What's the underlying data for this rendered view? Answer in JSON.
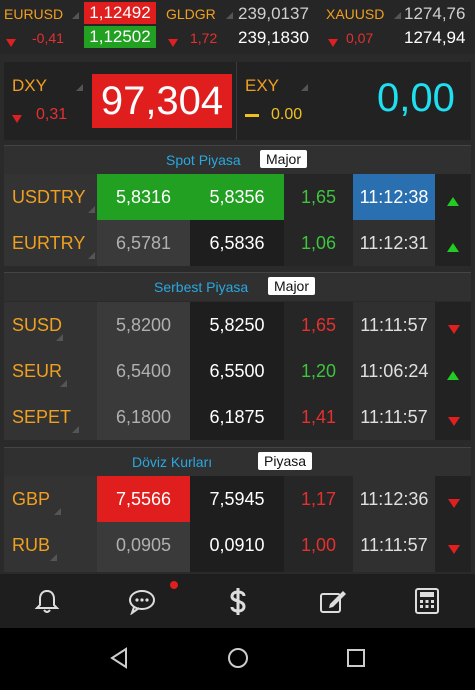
{
  "ticker": [
    {
      "name": "EURUSD",
      "change": "-0,41",
      "bid": "1,12492",
      "ask": "1,12502"
    },
    {
      "name": "GLDGR",
      "change": "1,72",
      "bid": "239,0137",
      "ask": "239,1830"
    },
    {
      "name": "XAUUSD",
      "change": "0,07",
      "bid": "1274,76",
      "ask": "1274,94"
    }
  ],
  "index": {
    "dxy": {
      "name": "DXY",
      "change": "0,31",
      "value": "97,304"
    },
    "exy": {
      "name": "EXY",
      "change": "0.00",
      "value": "0,00"
    }
  },
  "sections": [
    {
      "title": "Spot Piyasa",
      "badge": "Major",
      "rows": [
        {
          "name": "USDTRY",
          "bid": "5,8316",
          "ask": "5,8356",
          "change": "1,65",
          "time": "11:12:38",
          "dir": "up",
          "changeColor": "green"
        },
        {
          "name": "EURTRY",
          "bid": "6,5781",
          "ask": "6,5836",
          "change": "1,06",
          "time": "11:12:31",
          "dir": "up",
          "changeColor": "green"
        }
      ]
    },
    {
      "title": "Serbest Piyasa",
      "badge": "Major",
      "rows": [
        {
          "name": "SUSD",
          "bid": "5,8200",
          "ask": "5,8250",
          "change": "1,65",
          "time": "11:11:57",
          "dir": "down",
          "changeColor": "red"
        },
        {
          "name": "SEUR",
          "bid": "6,5400",
          "ask": "6,5500",
          "change": "1,20",
          "time": "11:06:24",
          "dir": "up",
          "changeColor": "green"
        },
        {
          "name": "SEPET",
          "bid": "6,1800",
          "ask": "6,1875",
          "change": "1,41",
          "time": "11:11:57",
          "dir": "down",
          "changeColor": "red"
        }
      ]
    },
    {
      "title": "Döviz Kurları",
      "badge": "Piyasa",
      "rows": [
        {
          "name": "GBP",
          "bid": "7,5566",
          "ask": "7,5945",
          "change": "1,17",
          "time": "11:12:36",
          "dir": "down",
          "changeColor": "red"
        },
        {
          "name": "RUB",
          "bid": "0,0905",
          "ask": "0,0910",
          "change": "1,00",
          "time": "11:11:57",
          "dir": "down",
          "changeColor": "red"
        }
      ]
    }
  ],
  "bottom_nav": [
    "bell-icon",
    "chat-icon",
    "dollar-icon",
    "edit-icon",
    "calculator-icon"
  ],
  "system_nav": [
    "back-icon",
    "home-icon",
    "recents-icon"
  ],
  "colors": {
    "accent_orange": "#f0a020",
    "up_green": "#22cc22",
    "down_red": "#e02020",
    "highlight_red": "#e01e1e",
    "highlight_green": "#22a022",
    "highlight_blue": "#2a6fb0",
    "title_blue": "#29a8e0",
    "exy_cyan": "#1ee0f0"
  }
}
